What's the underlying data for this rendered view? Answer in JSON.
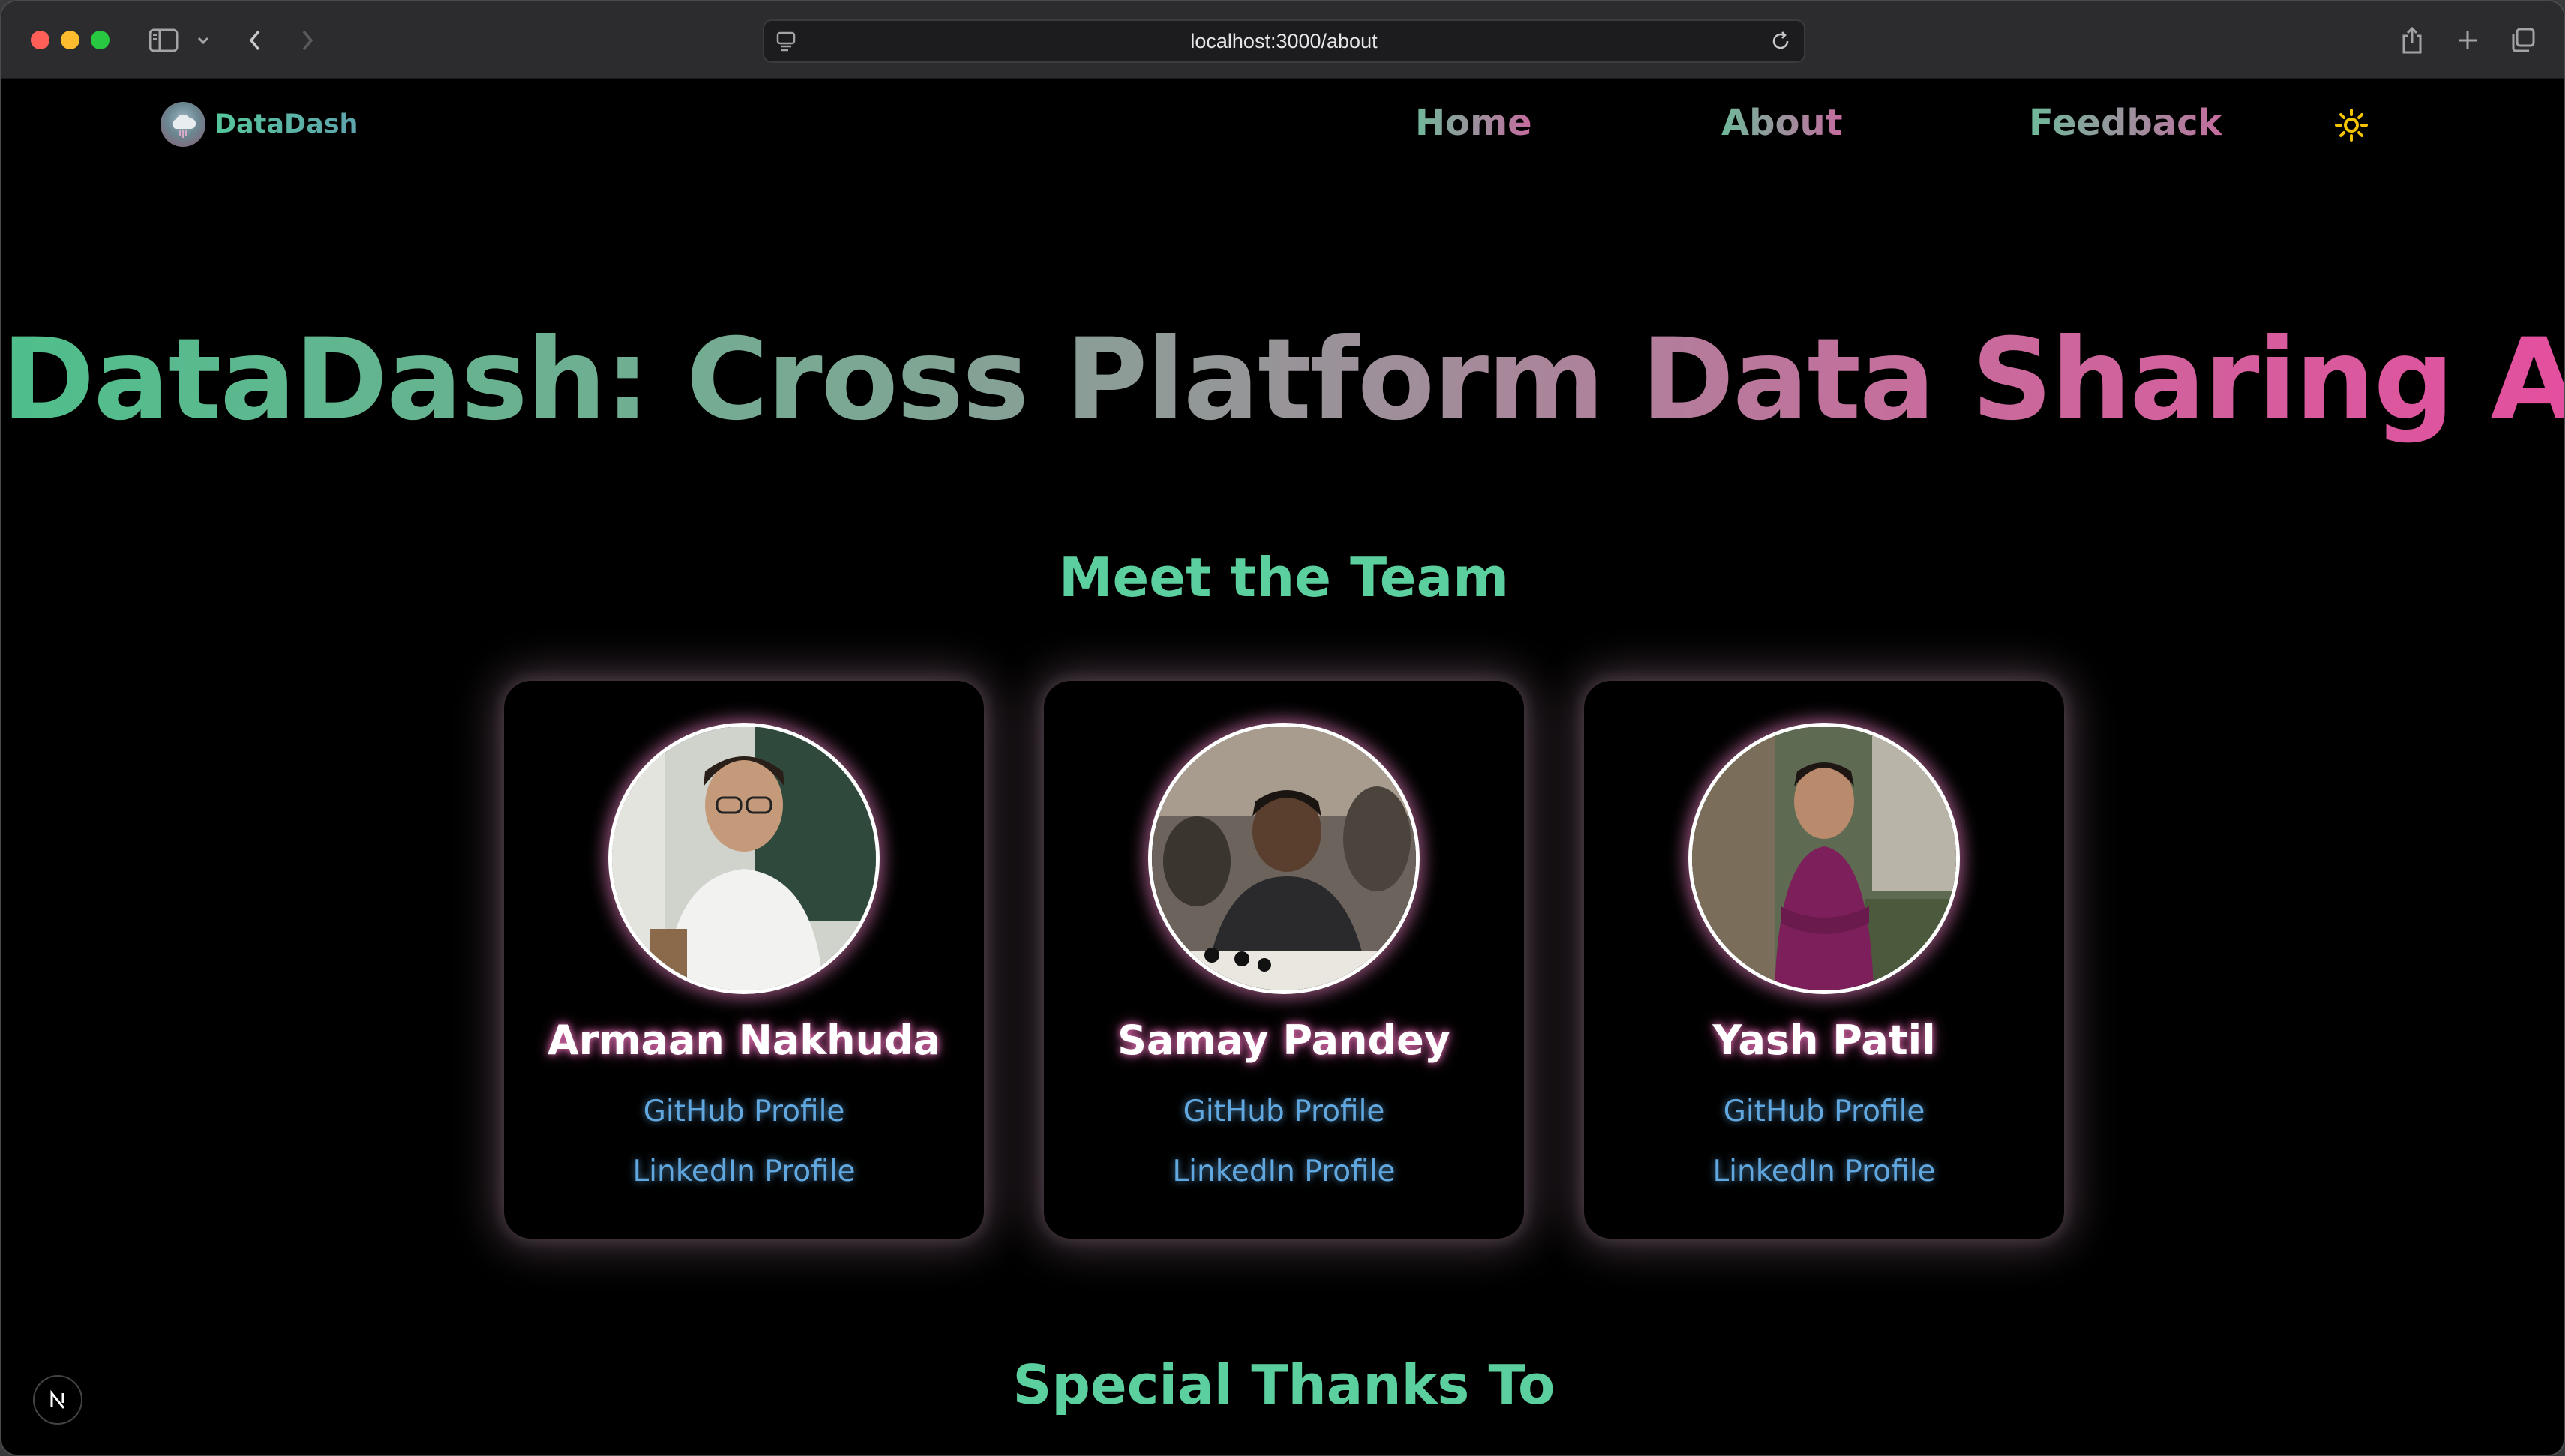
{
  "browser": {
    "url": "localhost:3000/about"
  },
  "site": {
    "logo_text": "DataDash",
    "nav": {
      "home": "Home",
      "about": "About",
      "feedback": "Feedback"
    }
  },
  "page": {
    "title": "DataDash: Cross Platform Data Sharing App",
    "team_heading": "Meet the Team",
    "thanks_heading": "Special Thanks To"
  },
  "team": [
    {
      "name": "Armaan Nakhuda",
      "github": "GitHub Profile",
      "linkedin": "LinkedIn Profile"
    },
    {
      "name": "Samay Pandey",
      "github": "GitHub Profile",
      "linkedin": "LinkedIn Profile"
    },
    {
      "name": "Yash Patil",
      "github": "GitHub Profile",
      "linkedin": "LinkedIn Profile"
    }
  ],
  "colors": {
    "accent_green": "#5bcf9e",
    "accent_pink": "#e34f9e",
    "link_blue": "#61a8e0",
    "sun": "#f5c400"
  },
  "icons": [
    "sidebar-icon",
    "chevron-down-icon",
    "back-icon",
    "forward-icon",
    "page-icon",
    "reload-icon",
    "share-icon",
    "new-tab-icon",
    "tabs-icon",
    "sun-icon",
    "nextjs-icon"
  ]
}
